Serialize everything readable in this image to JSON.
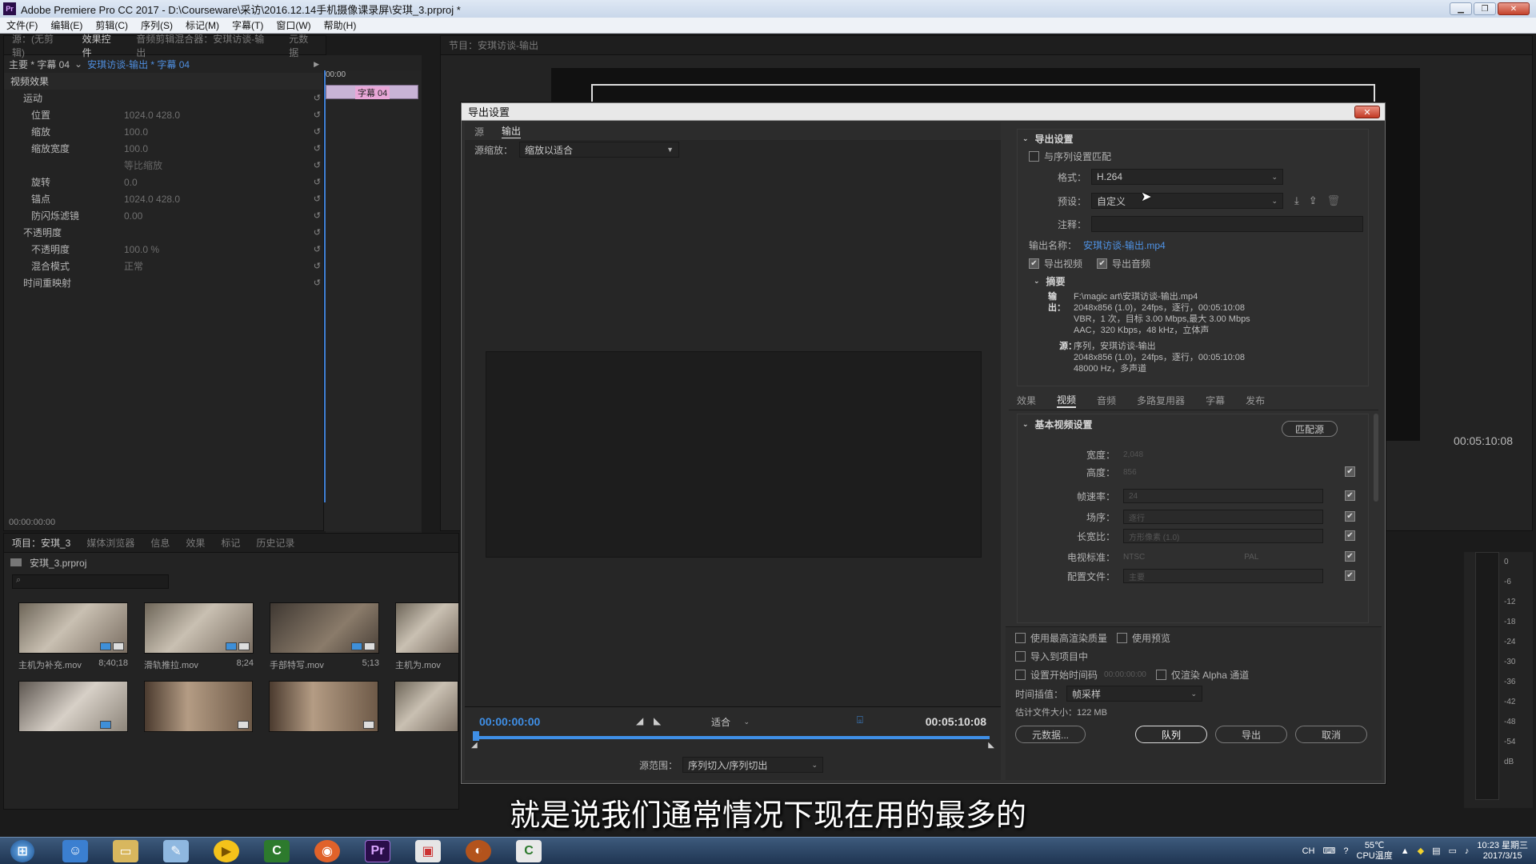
{
  "window": {
    "title": "Adobe Premiere Pro CC 2017 - D:\\Courseware\\采访\\2016.12.14手机摄像课录屏\\安琪_3.prproj *",
    "app_badge": "Pr"
  },
  "menu": [
    "文件(F)",
    "编辑(E)",
    "剪辑(C)",
    "序列(S)",
    "标记(M)",
    "字幕(T)",
    "窗口(W)",
    "帮助(H)"
  ],
  "top_panel_tabs": [
    "源：(无剪辑)",
    "效果控件",
    "音频剪辑混合器：安琪访谈-输出",
    "元数据"
  ],
  "program_tab": "节目：安琪访谈-输出",
  "effect_controls": {
    "breadcrumb_master": "主要 * 字幕 04",
    "breadcrumb_clip": "安琪访谈-输出 * 字幕 04",
    "time_start": "00:00",
    "clip_label": "字幕 04",
    "section_title": "视频效果",
    "rows": [
      {
        "name": "运动",
        "values": ""
      },
      {
        "name": "位置",
        "values": "1024.0    428.0"
      },
      {
        "name": "缩放",
        "values": "100.0"
      },
      {
        "name": "缩放宽度",
        "values": "100.0"
      },
      {
        "name": "等比缩放",
        "values": ""
      },
      {
        "name": "旋转",
        "values": "0.0"
      },
      {
        "name": "锚点",
        "values": "1024.0    428.0"
      },
      {
        "name": "防闪烁滤镜",
        "values": "0.00"
      },
      {
        "name": "不透明度",
        "values": ""
      },
      {
        "name": "不透明度",
        "values": "100.0 %"
      },
      {
        "name": "混合模式",
        "values": "正常"
      },
      {
        "name": "时间重映射",
        "values": ""
      }
    ],
    "timecode": "00:00:00:00"
  },
  "project_panel": {
    "tabs": [
      "项目：安琪_3",
      "媒体浏览器",
      "信息",
      "效果",
      "标记",
      "历史记录"
    ],
    "file": "安琪_3.prproj",
    "clips": [
      {
        "name": "主机为补充.mov",
        "dur": "8;40;18"
      },
      {
        "name": "滑轨推拉.mov",
        "dur": "8;24"
      },
      {
        "name": "手部特写.mov",
        "dur": "5;13"
      },
      {
        "name": "主机为.mov",
        "dur": ""
      }
    ]
  },
  "program_monitor": {
    "timecode_right": "00:05:10:08"
  },
  "audio_meter": {
    "ticks": [
      "0",
      "-6",
      "-12",
      "-18",
      "-24",
      "-30",
      "-36",
      "-42",
      "-48",
      "-54",
      "dB"
    ]
  },
  "dialog": {
    "title": "导出设置",
    "close": "✕",
    "left_tabs": [
      "源",
      "输出"
    ],
    "source_scaling_label": "源缩放：",
    "source_scaling_value": "缩放以适合",
    "timecode_in": "00:00:00:00",
    "fit_value": "适合",
    "timecode_out": "00:05:10:08",
    "source_range_label": "源范围：",
    "source_range_value": "序列切入/序列切出",
    "export_settings_title": "导出设置",
    "match_sequence": "与序列设置匹配",
    "format_label": "格式：",
    "format_value": "H.264",
    "preset_label": "预设：",
    "preset_value": "自定义",
    "comments_label": "注释：",
    "output_name_label": "输出名称：",
    "output_name_value": "安琪访谈-输出.mp4",
    "export_video": "导出视频",
    "export_audio": "导出音频",
    "summary_title": "摘要",
    "summary_output_label": "输出：",
    "summary_output_lines": [
      "F:\\magic art\\安琪访谈-输出.mp4",
      "2048x856 (1.0)，24fps，逐行，00:05:10:08",
      "VBR，1 次，目标 3.00 Mbps,最大 3.00 Mbps",
      "AAC，320 Kbps，48 kHz，立体声"
    ],
    "summary_source_label": "源：",
    "summary_source_lines": [
      "序列，安琪访谈-输出",
      "2048x856 (1.0)，24fps，逐行，00:05:10:08",
      "48000 Hz，多声道"
    ],
    "settings_tabs": [
      "效果",
      "视频",
      "音频",
      "多路复用器",
      "字幕",
      "发布"
    ],
    "basic_video_title": "基本视频设置",
    "match_source_button": "匹配源",
    "video_settings": [
      {
        "label": "宽度：",
        "value": "2,048"
      },
      {
        "label": "高度：",
        "value": "856"
      },
      {
        "label": "帧速率：",
        "value": "24"
      },
      {
        "label": "场序：",
        "value": "逐行"
      },
      {
        "label": "长宽比：",
        "value": "方形像素 (1.0)"
      },
      {
        "label": "电视标准：",
        "value": ""
      },
      {
        "label": "配置文件：",
        "value": "主要"
      }
    ],
    "tv_ntsc": "NTSC",
    "tv_pal": "PAL",
    "max_render_quality": "使用最高渲染质量",
    "use_previews": "使用预览",
    "import_into_project": "导入到项目中",
    "set_start_timecode": "设置开始时间码",
    "start_timecode_value": "00:00:00:00",
    "render_alpha_only": "仅渲染 Alpha 通道",
    "time_interpolation_label": "时间插值：",
    "time_interpolation_value": "帧采样",
    "estimated_size": "估计文件大小：122 MB",
    "buttons": {
      "metadata": "元数据...",
      "queue": "队列",
      "export": "导出",
      "cancel": "取消"
    }
  },
  "subtitle": "就是说我们通常情况下现在用的最多的",
  "taskbar": {
    "tray_text": "CH",
    "temp": "55℃",
    "temp_label": "CPU温度",
    "time": "10:23 星期三",
    "date": "2017/3/15"
  }
}
